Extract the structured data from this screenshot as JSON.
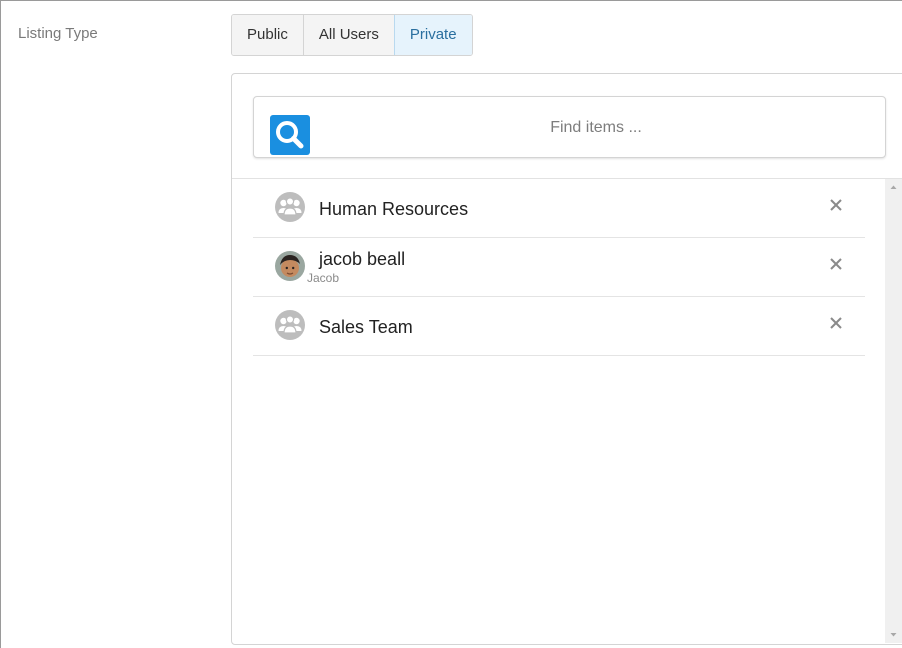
{
  "field": {
    "label": "Listing Type"
  },
  "listing_type": {
    "options": [
      "Public",
      "All Users",
      "Private"
    ],
    "selected": "Private"
  },
  "search": {
    "placeholder": "Find items ..."
  },
  "items": [
    {
      "name": "Human Resources",
      "subtitle": "",
      "icon": "group-icon"
    },
    {
      "name": "jacob beall",
      "subtitle": "Jacob",
      "icon": "user-avatar"
    },
    {
      "name": "Sales Team",
      "subtitle": "",
      "icon": "group-icon"
    }
  ],
  "colors": {
    "accent": "#1a8fe0",
    "selected_bg": "#e6f3fc",
    "group_icon": "#bdbdbd"
  }
}
